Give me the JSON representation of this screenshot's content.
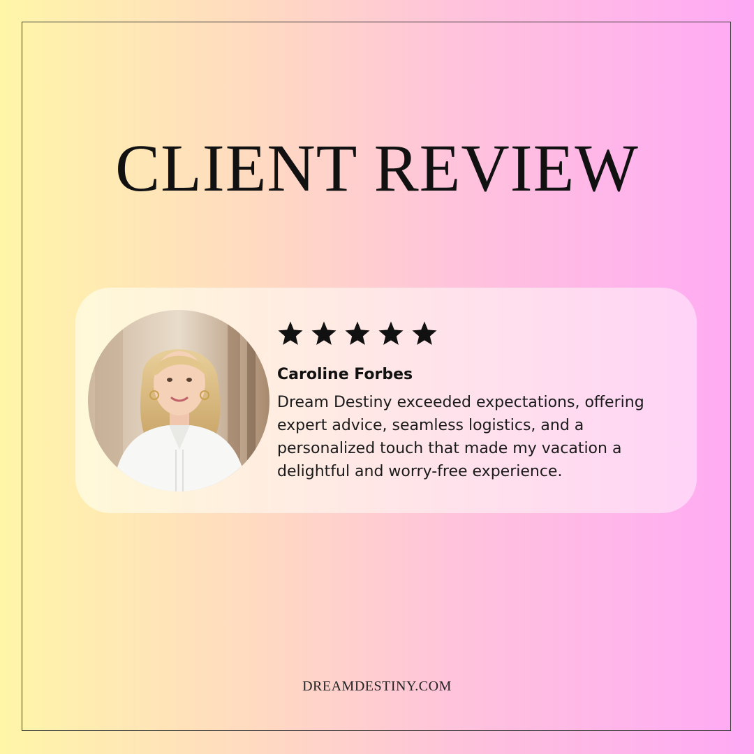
{
  "headline": "CLIENT REVIEW",
  "review": {
    "rating": 5,
    "rating_max": 5,
    "reviewer_name": "Caroline Forbes",
    "quote_lines": [
      "Dream Destiny exceeded expectations, offering",
      "expert advice, seamless logistics, and a",
      "personalized touch that made my vacation a",
      "delightful and worry-free experience."
    ]
  },
  "footer": {
    "website": "DREAMDESTINY.COM"
  },
  "colors": {
    "gradient_left": "#fff6a8",
    "gradient_right": "#ffa9f5",
    "text": "#111111",
    "star": "#111111"
  },
  "icons": {
    "star": "star-icon",
    "avatar": "reviewer-photo"
  }
}
